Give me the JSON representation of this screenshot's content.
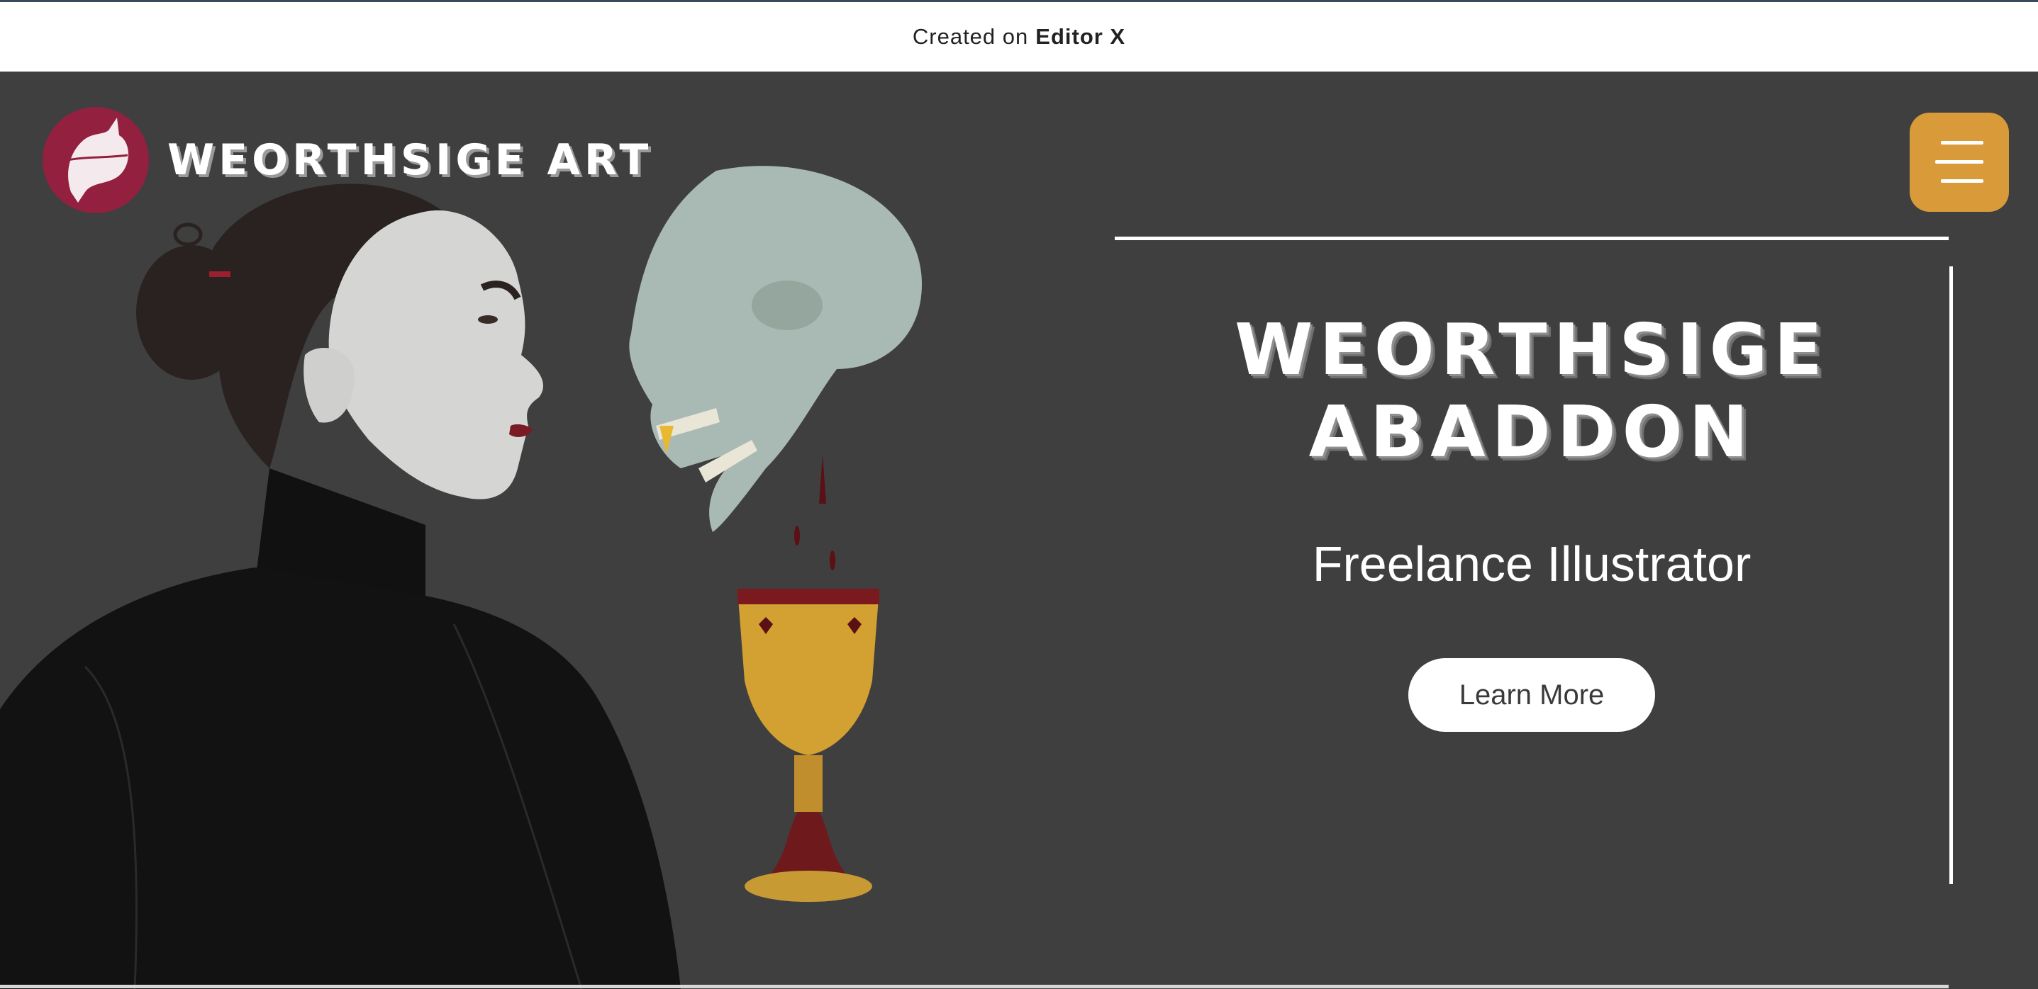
{
  "topbar": {
    "created_on": "Created on",
    "brand": "Editor X"
  },
  "header": {
    "site_title": "WEORTHSIGE ART",
    "logo_icon": "fox-logo-icon",
    "menu_icon": "hamburger-menu-icon"
  },
  "hero": {
    "name_line1": "WEORTHSIGE",
    "name_line2": "ABADDON",
    "subtitle": "Freelance Illustrator",
    "cta_label": "Learn More",
    "illustration": "woman-skull-goblet-illustration"
  },
  "colors": {
    "page_background": "#3f3f3f",
    "topbar_background": "#ffffff",
    "logo_background": "#93203f",
    "menu_button": "#d99a3a",
    "cta_background": "#ffffff",
    "cta_text": "#3a3a3a"
  }
}
